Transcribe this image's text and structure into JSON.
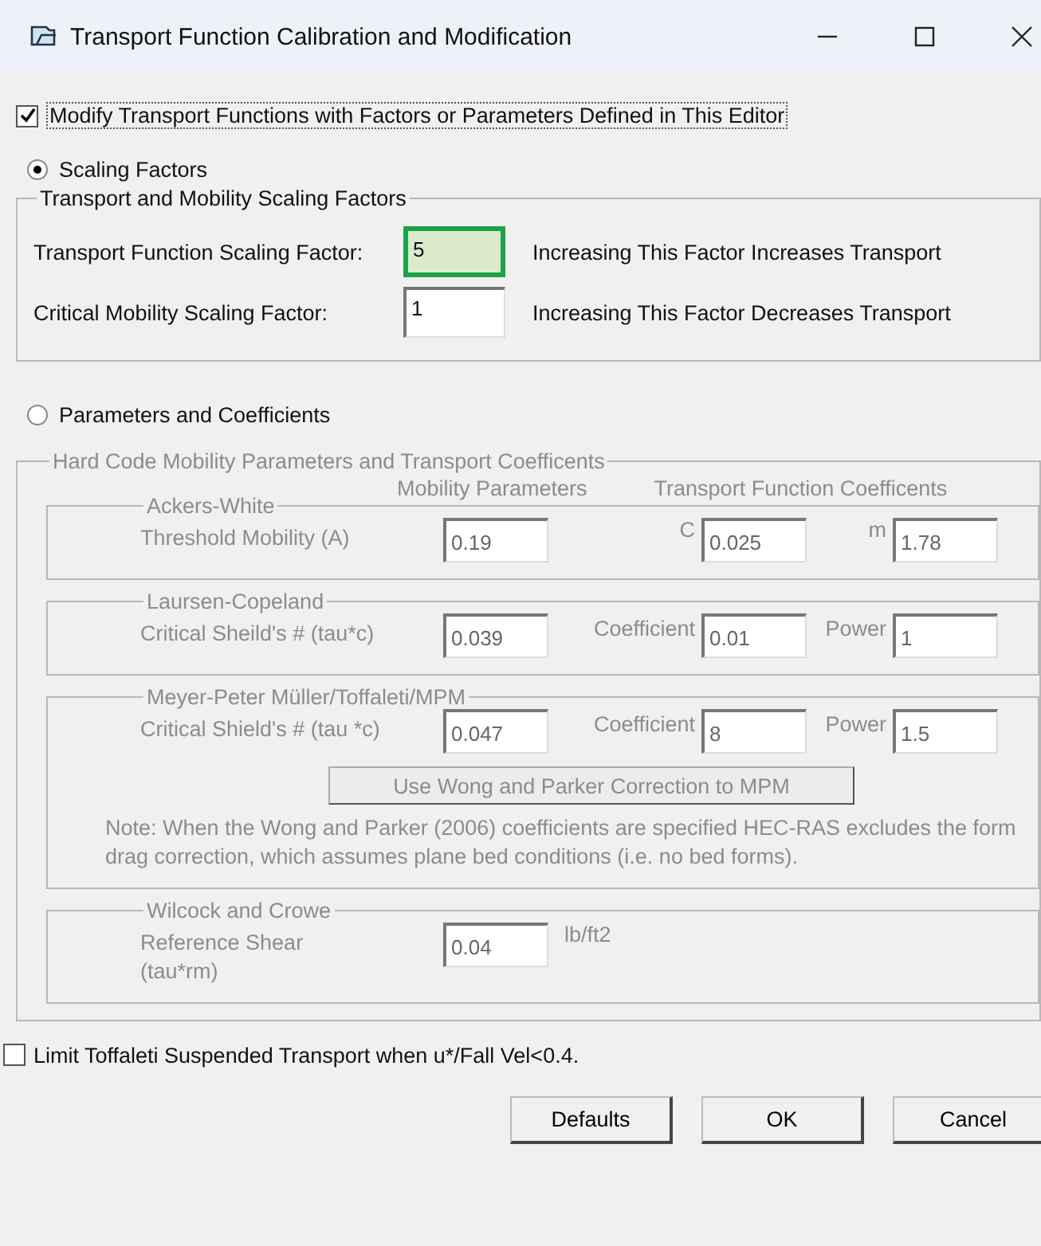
{
  "window": {
    "title": "Transport Function Calibration and Modification"
  },
  "modify_checkbox": {
    "label": "Modify Transport Functions with Factors or Parameters Defined in This Editor",
    "checked": true
  },
  "scaling_mode": {
    "label": "Scaling Factors",
    "selected": true
  },
  "scaling_group": {
    "title": "Transport and Mobility Scaling Factors",
    "rows": [
      {
        "label": "Transport Function Scaling Factor:",
        "value": "5",
        "highlighted": true,
        "note": "Increasing This Factor Increases Transport"
      },
      {
        "label": "Critical Mobility Scaling Factor:",
        "value": "1",
        "highlighted": false,
        "note": "Increasing This Factor Decreases Transport"
      }
    ]
  },
  "parameters_mode": {
    "label": "Parameters and Coefficients",
    "selected": false
  },
  "hard_code_group": {
    "title": "Hard Code Mobility Parameters and Transport Coefficents",
    "disabled": true,
    "column_headers": [
      "Mobility Parameters",
      "Transport Function Coefficents"
    ],
    "groups": [
      {
        "title": "Ackers-White",
        "main": {
          "label": "Threshold Mobility (A)",
          "value": "0.19"
        },
        "coefficients": [
          {
            "label": "C",
            "value": "0.025"
          },
          {
            "label": "m",
            "value": "1.78"
          }
        ]
      },
      {
        "title": "Laursen-Copeland",
        "main": {
          "label": "Critical Sheild's # (tau*c)",
          "value": "0.039"
        },
        "coefficients": [
          {
            "label": "Coefficient",
            "value": "0.01"
          },
          {
            "label": "Power",
            "value": "1"
          }
        ]
      },
      {
        "title": "Meyer-Peter Müller/Toffaleti/MPM",
        "main": {
          "label": "Critical Shield's # (tau *c)",
          "value": "0.047"
        },
        "coefficients": [
          {
            "label": "Coefficient",
            "value": "8"
          },
          {
            "label": "Power",
            "value": "1.5"
          }
        ],
        "button": "Use Wong and Parker Correction to MPM",
        "note": "Note: When the Wong and Parker (2006) coefficients are specified HEC-RAS excludes the form drag correction, which assumes plane bed conditions (i.e. no bed forms)."
      },
      {
        "title": "Wilcock and Crowe",
        "main": {
          "label": "Reference Shear",
          "label_line_2": "(tau*rm)",
          "value": "0.04"
        },
        "unit": "lb/ft2"
      }
    ]
  },
  "limit_checkbox": {
    "label": "Limit Toffaleti Suspended Transport when u*/Fall Vel<0.4.",
    "checked": false
  },
  "buttons": [
    "Defaults",
    "OK",
    "Cancel"
  ]
}
